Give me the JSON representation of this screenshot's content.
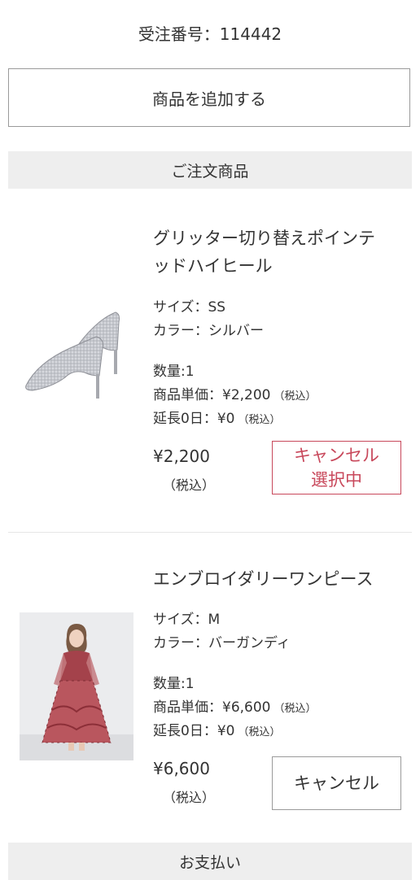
{
  "order": {
    "number_text": "受注番号：114442"
  },
  "add_button": {
    "label": "商品を追加する"
  },
  "sections": {
    "ordered_items": "ご注文商品",
    "payment": "お支払い"
  },
  "items": [
    {
      "name_line1": "グリッター切り替えポインテ",
      "name_line2": "ッドハイヒール",
      "size": "サイズ：SS",
      "color": "カラー：シルバー",
      "quantity": "数量:1",
      "unit_price": "商品単価：¥2,200",
      "extension": "延長0日：¥0",
      "tax_note": "（税込）",
      "price": "¥2,200",
      "price_tax": "（税込）",
      "cancel_line1": "キャンセル",
      "cancel_line2": "選択中",
      "cancel_state": "selected",
      "image_icon": "silver-glitter-pumps-image"
    },
    {
      "name_line1": "エンブロイダリーワンピース",
      "size": "サイズ：M",
      "color": "カラー：バーガンディ",
      "quantity": "数量:1",
      "unit_price": "商品単価：¥6,600",
      "extension": "延長0日：¥0",
      "tax_note": "（税込）",
      "price": "¥6,600",
      "price_tax": "（税込）",
      "cancel_line1": "キャンセル",
      "cancel_state": "normal",
      "image_icon": "burgundy-embroidered-dress-image"
    }
  ],
  "colors": {
    "accent": "#c8485b",
    "header_bg": "#eeeeee",
    "border": "#9a9a9a"
  }
}
